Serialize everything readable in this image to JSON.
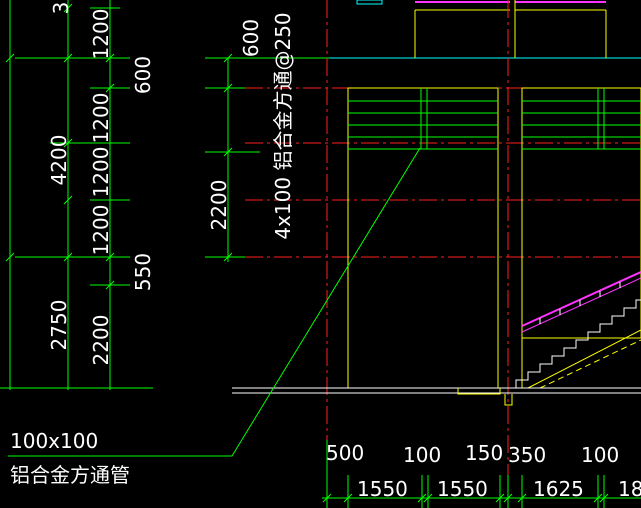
{
  "colors": {
    "background": "#000000",
    "dim_line": "#00ff00",
    "wall_line": "#ffff00",
    "axis_line": "#ff2020",
    "rail_line": "#ff33ff",
    "misc_line": "#00ffff",
    "text": "#ffffff",
    "ground_line": "#ffffff"
  },
  "left_dims": {
    "outer_col": {
      "top_fragment": "3",
      "total": "4200",
      "bottom": "2750"
    },
    "inner_col": [
      "1200",
      "1200",
      "1200",
      "1200",
      "2200"
    ],
    "right_col": [
      "600",
      "550"
    ]
  },
  "middle_dims": [
    "600",
    "2200"
  ],
  "rotated_note": "4x100 铝合金方通@250",
  "callout": {
    "line1": "100x100",
    "line2": "铝合金方通管"
  },
  "bottom_dims": {
    "row1": [
      "500",
      "100",
      "150",
      "350",
      "100"
    ],
    "row2": [
      "1550",
      "1550",
      "1625",
      "18"
    ]
  }
}
